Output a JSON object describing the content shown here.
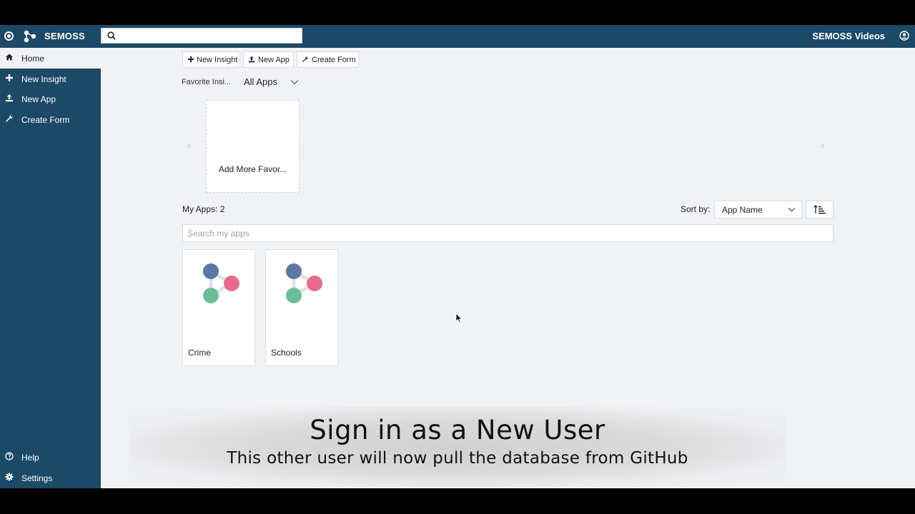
{
  "topbar": {
    "brand": "SEMOSS",
    "search_placeholder": "",
    "account_name": "SEMOSS Videos"
  },
  "sidebar": {
    "items": [
      {
        "label": "Home",
        "icon": "home-icon"
      },
      {
        "label": "New Insight",
        "icon": "plus-icon"
      },
      {
        "label": "New App",
        "icon": "upload-icon"
      },
      {
        "label": "Create Form",
        "icon": "wrench-icon"
      },
      {
        "label": "Help",
        "icon": "help-icon"
      },
      {
        "label": "Settings",
        "icon": "gear-icon"
      }
    ]
  },
  "toolbar": {
    "new_insight": "New Insight",
    "new_app": "New App",
    "create_form": "Create Form"
  },
  "favorites": {
    "label": "Favorite Insi...",
    "filter_value": "All Apps",
    "add_more": "Add More Favor..."
  },
  "apps": {
    "count_label": "My Apps: 2",
    "sort_label": "Sort by:",
    "sort_value": "App Name",
    "search_placeholder": "Search my apps",
    "items": [
      {
        "name": "Crime"
      },
      {
        "name": "Schools"
      }
    ],
    "icon_colors": {
      "blue": "#5b77a4",
      "pink": "#ea6a8f",
      "green": "#6dbd9b",
      "link": "#dfe3e7"
    }
  },
  "caption": {
    "title": "Sign in as a New User",
    "subtitle": "This other user will now pull the database from GitHub"
  },
  "colors": {
    "nav_bg": "#1c4966",
    "page_bg": "#f0f2f5"
  }
}
